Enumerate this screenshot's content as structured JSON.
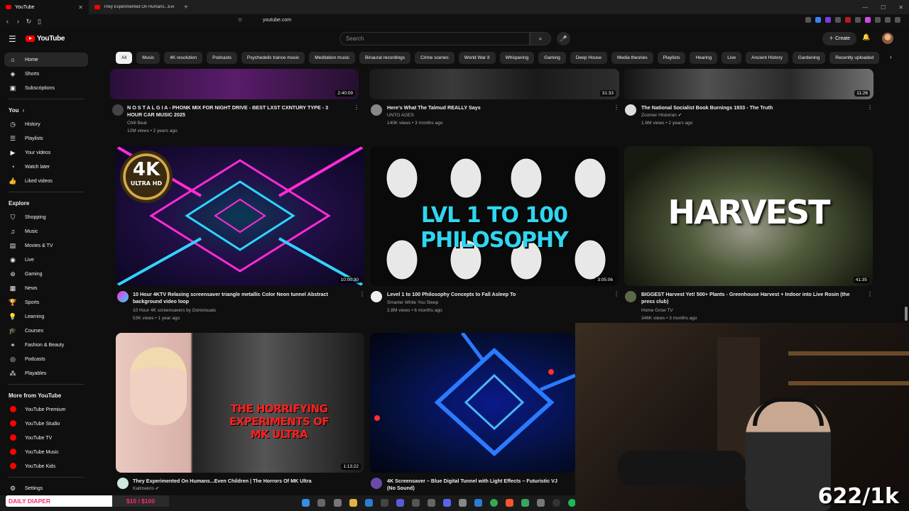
{
  "browser": {
    "tabs": [
      {
        "label": "YouTube",
        "active": true
      },
      {
        "label": "They Experimented On Humans...Even",
        "active": false
      }
    ],
    "url": "youtube.com"
  },
  "header": {
    "logo_text": "YouTube",
    "search_placeholder": "Search",
    "create_label": "Create"
  },
  "sidebar": {
    "main": [
      {
        "label": "Home",
        "icon": "home-icon"
      },
      {
        "label": "Shorts",
        "icon": "shorts-icon"
      },
      {
        "label": "Subscriptions",
        "icon": "subscriptions-icon"
      }
    ],
    "you_title": "You",
    "you": [
      {
        "label": "History",
        "icon": "history-icon"
      },
      {
        "label": "Playlists",
        "icon": "playlists-icon"
      },
      {
        "label": "Your videos",
        "icon": "your-videos-icon"
      },
      {
        "label": "Watch later",
        "icon": "watch-later-icon"
      },
      {
        "label": "Liked videos",
        "icon": "liked-icon"
      }
    ],
    "explore_title": "Explore",
    "explore": [
      {
        "label": "Shopping",
        "icon": "shopping-icon"
      },
      {
        "label": "Music",
        "icon": "music-icon"
      },
      {
        "label": "Movies & TV",
        "icon": "movies-icon"
      },
      {
        "label": "Live",
        "icon": "live-icon"
      },
      {
        "label": "Gaming",
        "icon": "gaming-icon"
      },
      {
        "label": "News",
        "icon": "news-icon"
      },
      {
        "label": "Sports",
        "icon": "sports-icon"
      },
      {
        "label": "Learning",
        "icon": "learning-icon"
      },
      {
        "label": "Courses",
        "icon": "courses-icon"
      },
      {
        "label": "Fashion & Beauty",
        "icon": "fashion-icon"
      },
      {
        "label": "Podcasts",
        "icon": "podcasts-icon"
      },
      {
        "label": "Playables",
        "icon": "playables-icon"
      }
    ],
    "more_title": "More from YouTube",
    "more": [
      {
        "label": "YouTube Premium"
      },
      {
        "label": "YouTube Studio"
      },
      {
        "label": "YouTube TV"
      },
      {
        "label": "YouTube Music"
      },
      {
        "label": "YouTube Kids"
      }
    ],
    "settings_label": "Settings"
  },
  "chips": [
    "All",
    "Music",
    "4K resolution",
    "Podcasts",
    "Psychedelic trance music",
    "Meditation music",
    "Binaural recordings",
    "Crime scenes",
    "World War II",
    "Whispering",
    "Gaming",
    "Deep House",
    "Media theories",
    "Playlists",
    "Hearing",
    "Live",
    "Ancient History",
    "Gardening",
    "Recently uploaded"
  ],
  "videos_row1": [
    {
      "duration": "2:40:09",
      "title_line1": "N O S T A L G I A - PHONK MIX FOR NIGHT DRIVE - BEST LXST CXNTURY TYPE - 3",
      "title_line2": "HOUR CAR MUSIC 2025",
      "channel": "Chill Beat",
      "stats": "12M views • 2 years ago"
    },
    {
      "duration": "31:33",
      "title_line1": "Here's What The Talmud REALLY Says",
      "title_line2": "",
      "channel": "UNTO AGES",
      "stats": "140K views • 3 months ago"
    },
    {
      "duration": "11:26",
      "title_line1": "The National Socialist Book Burnings 1933 - The Truth",
      "title_line2": "",
      "channel": "Zoomer Historian",
      "stats": "1.6M views • 2 years ago"
    }
  ],
  "videos_row2": [
    {
      "duration": "10:00:30",
      "title_line1": "10 Hour 4KTV Relaxing screensaver triangle metallic Color Neon tunnel Abstract",
      "title_line2": "background video loop",
      "channel": "10 Hour 4K screensavers by Donivisuals",
      "stats": "53K views • 1 year ago",
      "thumb_badge_top": "4K",
      "thumb_badge_bottom": "ULTRA HD"
    },
    {
      "duration": "3:05:06",
      "title_line1": "Level 1 to 100 Philosophy Concepts to Fall Asleep To",
      "title_line2": "",
      "channel": "Smarter While You Sleep",
      "stats": "2.8M views • 6 months ago",
      "thumb_text": "LVL 1 TO 100 PHILOSOPHY"
    },
    {
      "duration": "41:35",
      "title_line1": "BIGGEST Harvest Yet! 500+ Plants - Greenhouse Harvest + Indoor into Live Rosin (the",
      "title_line2": "press club)",
      "channel": "Home Grow TV",
      "stats": "346K views • 3 months ago",
      "thumb_text": "HARVEST"
    }
  ],
  "videos_row3": [
    {
      "duration": "1:13:22",
      "title_line1": "They Experimented On Humans...Even Children | The Horrors Of MK Ultra",
      "title_line2": "",
      "channel": "Kallmekris",
      "thumb_text_line1": "THE HORRIFYING EXPERIMENTS OF",
      "thumb_text_line2": "MK ULTRA"
    },
    {
      "duration": "",
      "title_line1": "4K Screensaver – Blue Digital Tunnel with Light Effects – Futuristic VJ",
      "title_line2": "(No Sound)",
      "channel": ""
    }
  ],
  "overlay": {
    "promo_left": "DAILY DIAPER",
    "promo_right": "$10 / $100",
    "counter": "622/1k"
  }
}
